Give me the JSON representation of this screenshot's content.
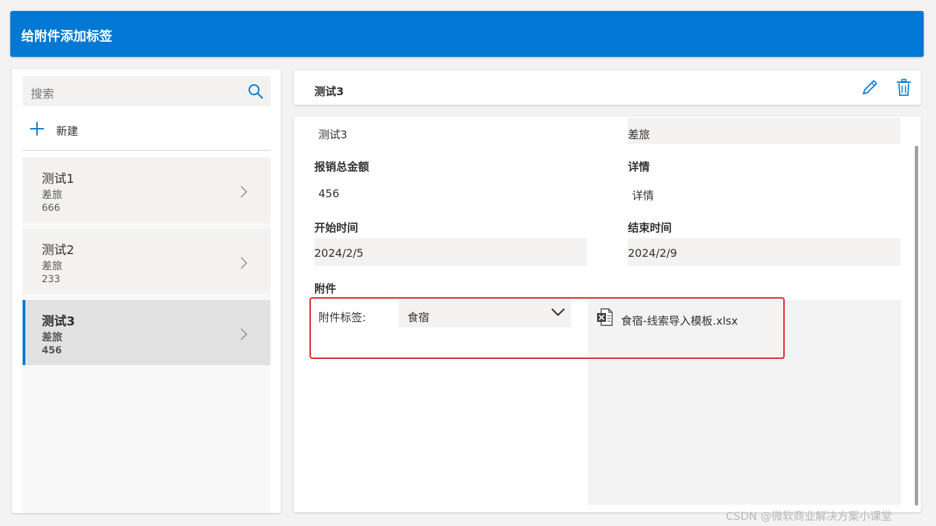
{
  "header": {
    "title": "给附件添加标签"
  },
  "search": {
    "placeholder": "搜索",
    "icon": "search-icon"
  },
  "new_button": {
    "label": "新建",
    "icon": "plus-icon"
  },
  "list": {
    "items": [
      {
        "title": "测试1",
        "category": "差旅",
        "amount": "666"
      },
      {
        "title": "测试2",
        "category": "差旅",
        "amount": "233"
      },
      {
        "title": "测试3",
        "category": "差旅",
        "amount": "456",
        "selected": true
      }
    ]
  },
  "detail": {
    "title": "测试3",
    "edit_icon": "pencil-icon",
    "delete_icon": "trash-icon"
  },
  "form": {
    "name_value": "测试3",
    "type_value": "差旅",
    "total_label": "报销总金额",
    "total_value": "456",
    "details_label": "详情",
    "details_value": "详情",
    "start_label": "开始时间",
    "start_value": "2024/2/5",
    "end_label": "结束时间",
    "end_value": "2024/2/9",
    "attachment_label": "附件",
    "tag_label": "附件标签:",
    "tag_value": "食宿",
    "file_name": "食宿-线索导入模板.xlsx",
    "file_icon": "excel-file-icon"
  },
  "colors": {
    "accent": "#0078d4",
    "highlight": "#e02020"
  },
  "watermark": "CSDN @微软商业解决方案小课堂"
}
